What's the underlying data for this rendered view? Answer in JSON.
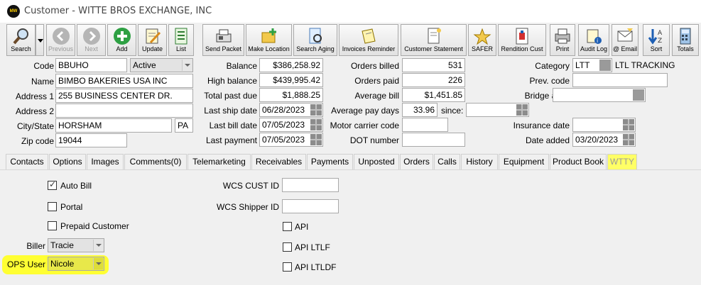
{
  "window": {
    "title": "Customer - WITTE BROS EXCHANGE, INC",
    "icon_text": "MW"
  },
  "toolbar": {
    "buttons": [
      {
        "label": "Search"
      },
      {
        "label": "Previous"
      },
      {
        "label": "Next"
      },
      {
        "label": "Add"
      },
      {
        "label": "Update"
      },
      {
        "label": "List"
      },
      {
        "label": "Send Packet"
      },
      {
        "label": "Make Location"
      },
      {
        "label": "Search Aging"
      },
      {
        "label": "Invoices Reminder"
      },
      {
        "label": "Customer Statement"
      },
      {
        "label": "SAFER"
      },
      {
        "label": "Rendition Cust"
      },
      {
        "label": "Print"
      },
      {
        "label": "Audit Log"
      },
      {
        "label": "@ Email"
      },
      {
        "label": "Sort"
      },
      {
        "label": "Totals"
      }
    ]
  },
  "customer": {
    "code_label": "Code",
    "code": "BBUHO",
    "status": "Active",
    "name_label": "Name",
    "name": "BIMBO BAKERIES USA INC",
    "address1_label": "Address 1",
    "address1": "255 BUSINESS CENTER DR.",
    "address2_label": "Address 2",
    "address2": "",
    "city_label": "City/State",
    "city": "HORSHAM",
    "state": "PA",
    "zip_label": "Zip code",
    "zip": "19044"
  },
  "financials": {
    "balance_label": "Balance",
    "balance": "$386,258.92",
    "high_balance_label": "High balance",
    "high_balance": "$439,995.42",
    "past_due_label": "Total past due",
    "past_due": "$1,888.25",
    "last_ship_label": "Last ship date",
    "last_ship": "06/28/2023",
    "last_bill_label": "Last bill date",
    "last_bill": "07/05/2023",
    "last_payment_label": "Last payment",
    "last_payment": "07/05/2023"
  },
  "orders": {
    "billed_label": "Orders billed",
    "billed": "531",
    "paid_label": "Orders paid",
    "paid": "226",
    "avg_bill_label": "Average bill",
    "avg_bill": "$1,451.85",
    "avg_pay_days_label": "Average pay days",
    "avg_pay_days": "33.96",
    "since_label": "since:",
    "since": "",
    "motor_carrier_label": "Motor carrier code",
    "motor_carrier": "",
    "dot_label": "DOT number",
    "dot": ""
  },
  "category": {
    "category_label": "Category",
    "category": "LTT",
    "category_desc": "LTL TRACKING",
    "prev_code_label": "Prev. code",
    "prev_code": "",
    "bridge_label": "Bridge acct.",
    "bridge": "",
    "insurance_label": "Insurance date",
    "insurance": "",
    "date_added_label": "Date added",
    "date_added": "03/20/2023"
  },
  "tabs": [
    "Contacts",
    "Options",
    "Images",
    "Comments(0)",
    "Telemarketing",
    "Receivables",
    "Payments",
    "Unposted",
    "Orders",
    "Calls",
    "History",
    "Equipment",
    "Product Book",
    "WTTY"
  ],
  "wtty": {
    "auto_bill": "Auto Bill",
    "auto_bill_checked": true,
    "portal": "Portal",
    "portal_checked": false,
    "prepaid": "Prepaid Customer",
    "prepaid_checked": false,
    "biller_label": "Biller",
    "biller": "Tracie",
    "ops_user_label": "OPS User",
    "ops_user": "Nicole",
    "wcs_cust_id_label": "WCS CUST ID",
    "wcs_cust_id": "",
    "wcs_shipper_id_label": "WCS Shipper ID",
    "wcs_shipper_id": "",
    "api": "API",
    "api_checked": false,
    "api_ltlf": "API LTLF",
    "api_ltlf_checked": false,
    "api_ltldf": "API LTLDF",
    "api_ltldf_checked": false
  },
  "colors": {
    "highlight": "#ffff33",
    "accent_blue": "#1e5fb4",
    "green_icon": "#2ea043"
  }
}
